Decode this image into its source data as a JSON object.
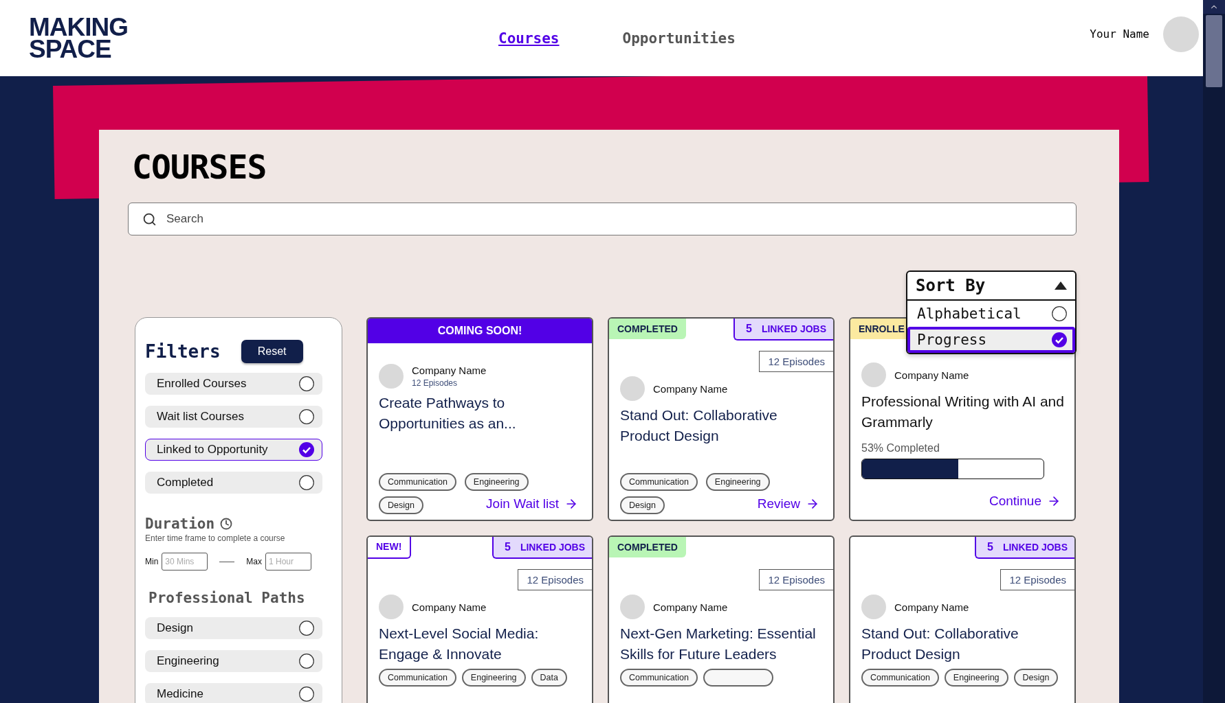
{
  "header": {
    "logo": [
      "MAKING",
      "SPACE"
    ],
    "nav": [
      {
        "label": "Courses",
        "selected": true
      },
      {
        "label": "Opportunities",
        "selected": false
      }
    ],
    "user_name": "Your Name"
  },
  "page": {
    "title": "COURSES",
    "search": {
      "placeholder": "Search"
    }
  },
  "sort": {
    "title": "Sort By",
    "expanded": true,
    "options": [
      {
        "label": "Alphabetical",
        "selected": false
      },
      {
        "label": "Progress",
        "selected": true
      }
    ]
  },
  "filters": {
    "title": "Filters",
    "reset": "Reset",
    "options": [
      {
        "label": "Enrolled Courses",
        "checked": false
      },
      {
        "label": "Wait list Courses",
        "checked": false
      },
      {
        "label": "Linked to Opportunity",
        "checked": true
      },
      {
        "label": "Completed",
        "checked": false
      }
    ],
    "duration": {
      "title": "Duration",
      "hint": "Enter time frame to complete a course",
      "min_label": "Min",
      "min_placeholder": "30 Mins",
      "max_label": "Max",
      "max_placeholder": "1 Hour"
    },
    "paths_title": "Professional Paths",
    "paths": [
      {
        "label": "Design",
        "checked": false
      },
      {
        "label": "Engineering",
        "checked": false
      },
      {
        "label": "Medicine",
        "checked": false
      }
    ]
  },
  "cards": [
    {
      "status": {
        "kind": "banner",
        "label": "COMING SOON!"
      },
      "company": "Company Name",
      "episodes_sub": "12 Episodes",
      "title": "Create Pathways to Opportunities as an...",
      "tags": [
        {
          "label": "Communication"
        },
        {
          "label": "Engineering"
        },
        {
          "label": "Design"
        }
      ],
      "action": "Join Wait list"
    },
    {
      "status": {
        "kind": "completed",
        "label": "COMPLETED"
      },
      "linked_jobs": {
        "count": "5",
        "label": "LINKED JOBS"
      },
      "episodes_box": "12 Episodes",
      "company": "Company Name",
      "title": "Stand Out: Collaborative Product Design",
      "tags": [
        {
          "label": "Communication"
        },
        {
          "label": "Engineering"
        },
        {
          "label": "Design"
        }
      ],
      "action": "Review"
    },
    {
      "status": {
        "kind": "enrolled",
        "label": "ENROLLE"
      },
      "company": "Company Name",
      "title": "Professional Writing with AI and Grammarly",
      "progress": {
        "label": "53% Completed",
        "level": 0.53
      },
      "action": "Continue"
    },
    {
      "status": {
        "kind": "new",
        "label": "NEW!"
      },
      "linked_jobs": {
        "count": "5",
        "label": "LINKED JOBS"
      },
      "episodes_box": "12 Episodes",
      "company": "Company Name",
      "title": "Next-Level Social Media: Engage & Innovate",
      "tags": [
        {
          "label": "Communication"
        },
        {
          "label": "Engineering"
        },
        {
          "label": "Data"
        }
      ]
    },
    {
      "status": {
        "kind": "completed",
        "label": "COMPLETED"
      },
      "episodes_box": "12 Episodes",
      "company": "Company Name",
      "title": "Next-Gen Marketing: Essential Skills for Future Leaders",
      "tags": [
        {
          "label": "Communication"
        },
        {
          "kind": "blank"
        }
      ]
    },
    {
      "linked_jobs": {
        "count": "5",
        "label": "LINKED JOBS"
      },
      "episodes_box": "12 Episodes",
      "company": "Company Name",
      "title": "Stand Out: Collaborative Product Design",
      "tags": [
        {
          "label": "Communication"
        },
        {
          "label": "Engineering"
        },
        {
          "label": "Design"
        }
      ]
    }
  ]
}
